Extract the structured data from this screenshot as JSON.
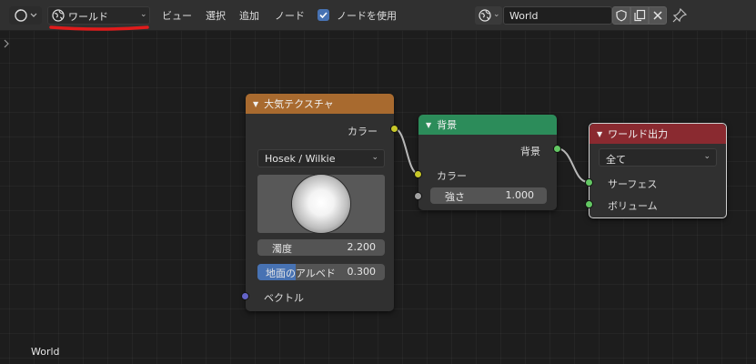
{
  "header": {
    "world_dropdown": "ワールド",
    "menus": [
      "ビュー",
      "選択",
      "追加",
      "ノード"
    ],
    "use_nodes_label": "ノードを使用",
    "use_nodes_checked": true,
    "world_name": "World",
    "icons": {
      "editor": "node-editor-icon",
      "world": "world-globe-icon",
      "fake_user": "shield-icon",
      "duplicate": "duplicate-icon",
      "unlink": "close-icon",
      "pin": "pin-icon"
    }
  },
  "nodes": {
    "sky": {
      "title": "大気テクスチャ",
      "output": "カラー",
      "sky_type": "Hosek / Wilkie",
      "turbidity": {
        "label": "濁度",
        "value": "2.200"
      },
      "ground_albedo": {
        "label": "地面のアルベド",
        "value": "0.300",
        "fraction": 0.3
      },
      "input": "ベクトル"
    },
    "background": {
      "title": "背景",
      "output": "背景",
      "color": "カラー",
      "strength": {
        "label": "強さ",
        "value": "1.000"
      }
    },
    "output": {
      "title": "ワールド出力",
      "target": "全て",
      "surface": "サーフェス",
      "volume": "ボリューム"
    }
  },
  "footer": {
    "world_label": "World"
  },
  "colors": {
    "sky_header": "#a86a2f",
    "background_header": "#2c8c5a",
    "output_header": "#8a2a30",
    "color_socket": "#c7c729",
    "shader_socket": "#63c763",
    "vector_socket": "#6363c7",
    "float_socket": "#a1a1a1",
    "accent": "#4772b3",
    "annotation_underline": "#e01b1b"
  }
}
